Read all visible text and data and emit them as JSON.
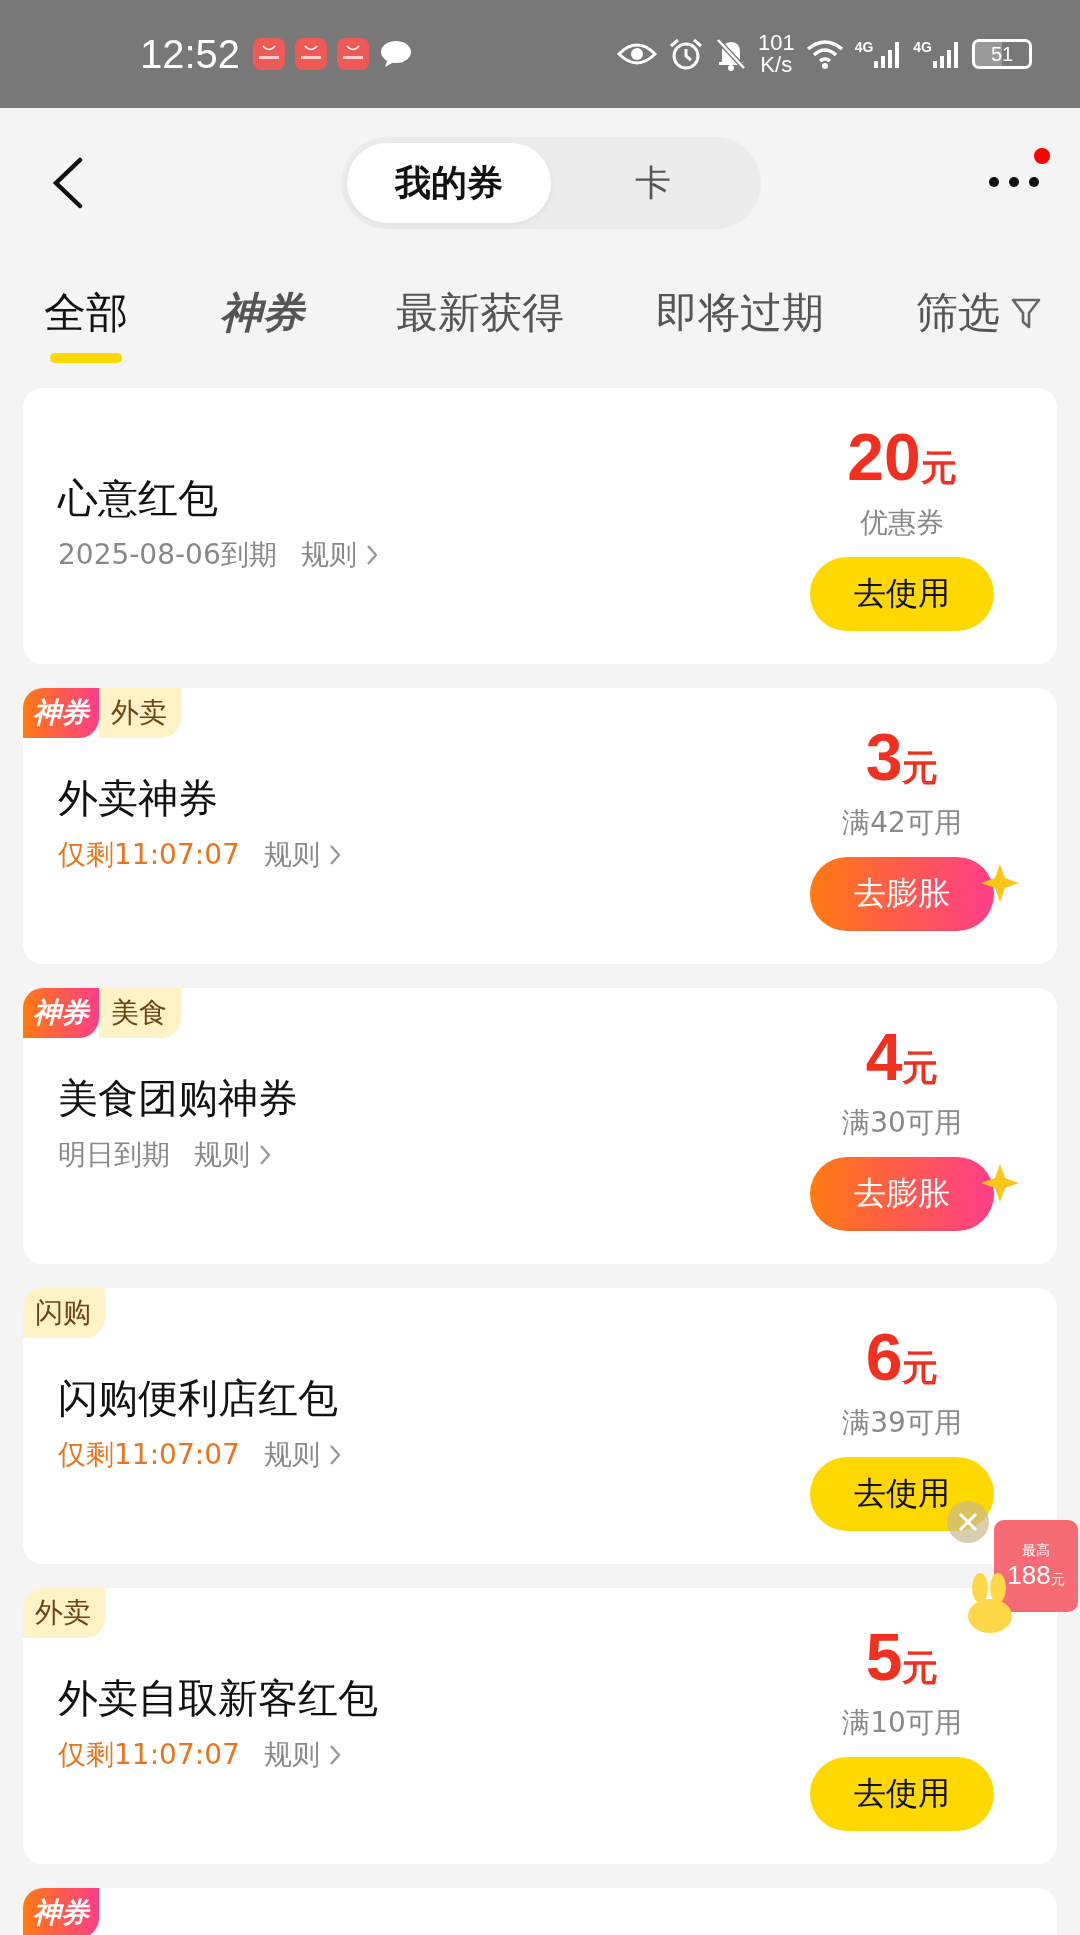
{
  "status_bar": {
    "time": "12:52",
    "net_speed": [
      "101",
      "K/s"
    ],
    "signal_labels": [
      "4G",
      "4G"
    ],
    "battery": "51"
  },
  "header": {
    "segments": [
      {
        "label": "我的券",
        "selected": true
      },
      {
        "label": "卡",
        "selected": false
      }
    ],
    "more_notification": true
  },
  "filter_tabs": [
    {
      "label": "全部",
      "kind": "text",
      "selected": true
    },
    {
      "label": "神券",
      "kind": "logo",
      "selected": false
    },
    {
      "label": "最新获得",
      "kind": "text",
      "selected": false
    },
    {
      "label": "即将过期",
      "kind": "text",
      "selected": false
    }
  ],
  "filter": {
    "label": "筛选"
  },
  "coupons": [
    {
      "title": "心意红包",
      "expiry": {
        "text": "2025-08-06到期",
        "urgent": false
      },
      "rules": "规则",
      "amount": "20",
      "unit": "元",
      "condition": "优惠券",
      "button": {
        "label": "去使用",
        "kind": "use"
      }
    },
    {
      "tags": [
        {
          "label": "神券",
          "kind": "shenquan"
        },
        {
          "label": "外卖",
          "kind": "category"
        }
      ],
      "title": "外卖神券",
      "expiry": {
        "text": "仅剩11:07:07",
        "urgent": true
      },
      "rules": "规则",
      "amount": "3",
      "unit": "元",
      "condition": "满42可用",
      "button": {
        "label": "去膨胀",
        "kind": "inflate"
      }
    },
    {
      "tags": [
        {
          "label": "神券",
          "kind": "shenquan"
        },
        {
          "label": "美食",
          "kind": "category"
        }
      ],
      "title": "美食团购神券",
      "expiry": {
        "text": "明日到期",
        "urgent": false
      },
      "rules": "规则",
      "amount": "4",
      "unit": "元",
      "condition": "满30可用",
      "button": {
        "label": "去膨胀",
        "kind": "inflate"
      }
    },
    {
      "tags": [
        {
          "label": "闪购",
          "kind": "category"
        }
      ],
      "title": "闪购便利店红包",
      "expiry": {
        "text": "仅剩11:07:07",
        "urgent": true
      },
      "rules": "规则",
      "amount": "6",
      "unit": "元",
      "condition": "满39可用",
      "button": {
        "label": "去使用",
        "kind": "use"
      }
    },
    {
      "tags": [
        {
          "label": "外卖",
          "kind": "category"
        }
      ],
      "title": "外卖自取新客红包",
      "expiry": {
        "text": "仅剩11:07:07",
        "urgent": true
      },
      "rules": "规则",
      "amount": "5",
      "unit": "元",
      "condition": "满10可用",
      "button": {
        "label": "去使用",
        "kind": "use"
      }
    },
    {
      "tags": [
        {
          "label": "神券",
          "kind": "shenquan"
        }
      ],
      "partial": true
    }
  ],
  "floating_widget": {
    "caption": "最高",
    "amount": "188",
    "unit": "元"
  }
}
